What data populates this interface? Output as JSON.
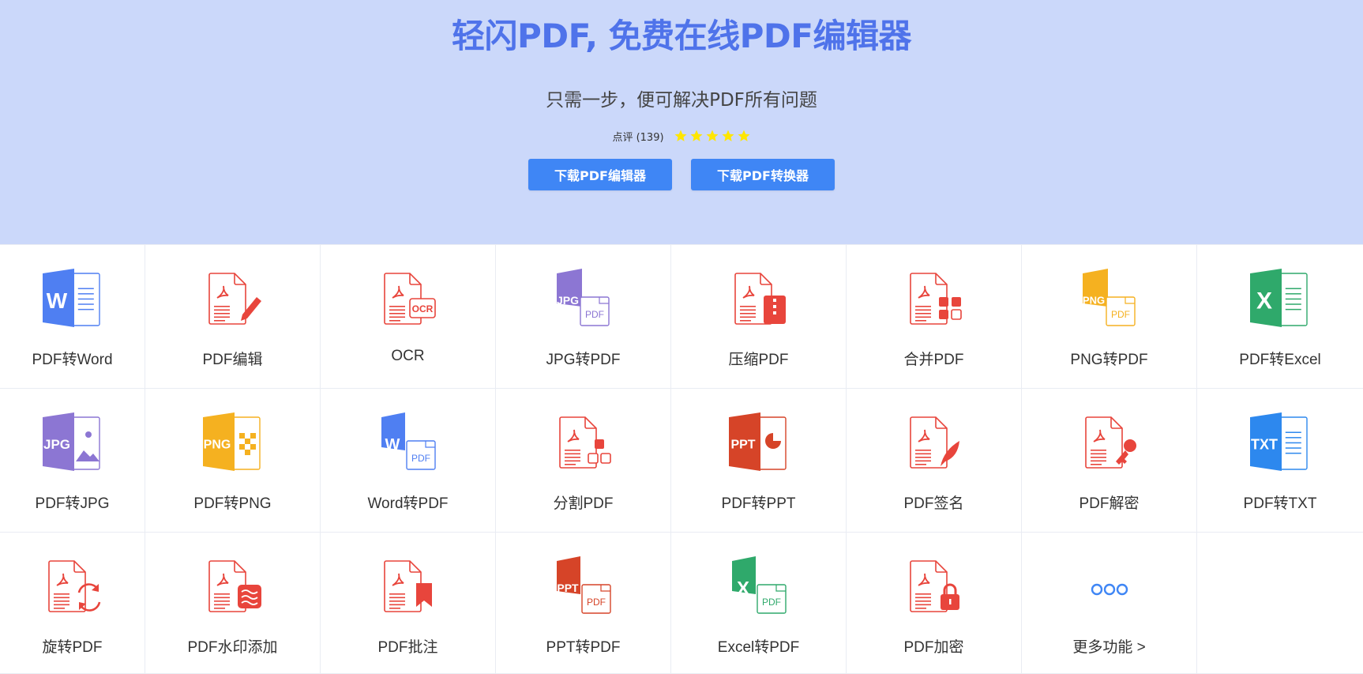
{
  "hero": {
    "title": "轻闪PDF, 免费在线PDF编辑器",
    "subtitle": "只需一步，便可解决PDF所有问题",
    "rating_label": "点评 (139)",
    "stars": 5,
    "download_editor": "下载PDF编辑器",
    "download_converter": "下载PDF转换器"
  },
  "colors": {
    "hero_bg": "#cbd8fa",
    "title": "#4f73ea",
    "button": "#3f86f5",
    "star": "#ffe600",
    "pdf_red": "#e8453c",
    "word_blue": "#4f7ff2",
    "excel_green": "#2fa96b",
    "jpg_purple": "#8c76d3",
    "png_yellow": "#f5b120",
    "ppt_red": "#d64428",
    "txt_blue": "#2d88ee"
  },
  "tools": [
    {
      "label": "PDF转Word",
      "icon": "pdf-to-word-icon"
    },
    {
      "label": "PDF编辑",
      "icon": "pdf-edit-icon"
    },
    {
      "label": "OCR",
      "icon": "ocr-icon"
    },
    {
      "label": "JPG转PDF",
      "icon": "jpg-to-pdf-icon"
    },
    {
      "label": "压缩PDF",
      "icon": "compress-pdf-icon"
    },
    {
      "label": "合并PDF",
      "icon": "merge-pdf-icon"
    },
    {
      "label": "PNG转PDF",
      "icon": "png-to-pdf-icon"
    },
    {
      "label": "PDF转Excel",
      "icon": "pdf-to-excel-icon"
    },
    {
      "label": "PDF转JPG",
      "icon": "pdf-to-jpg-icon"
    },
    {
      "label": "PDF转PNG",
      "icon": "pdf-to-png-icon"
    },
    {
      "label": "Word转PDF",
      "icon": "word-to-pdf-icon"
    },
    {
      "label": "分割PDF",
      "icon": "split-pdf-icon"
    },
    {
      "label": "PDF转PPT",
      "icon": "pdf-to-ppt-icon"
    },
    {
      "label": "PDF签名",
      "icon": "pdf-sign-icon"
    },
    {
      "label": "PDF解密",
      "icon": "pdf-decrypt-icon"
    },
    {
      "label": "PDF转TXT",
      "icon": "pdf-to-txt-icon"
    },
    {
      "label": "旋转PDF",
      "icon": "rotate-pdf-icon"
    },
    {
      "label": "PDF水印添加",
      "icon": "pdf-watermark-icon"
    },
    {
      "label": "PDF批注",
      "icon": "pdf-annotate-icon"
    },
    {
      "label": "PPT转PDF",
      "icon": "ppt-to-pdf-icon"
    },
    {
      "label": "Excel转PDF",
      "icon": "excel-to-pdf-icon"
    },
    {
      "label": "PDF加密",
      "icon": "pdf-encrypt-icon"
    },
    {
      "label": "更多功能 >",
      "icon": "more-icon"
    }
  ],
  "icon_text": {
    "word": "W",
    "excel": "X",
    "ocr": "OCR",
    "jpg": "JPG",
    "png": "PNG",
    "ppt": "PPT",
    "txt": "TXT",
    "pdf": "PDF"
  }
}
